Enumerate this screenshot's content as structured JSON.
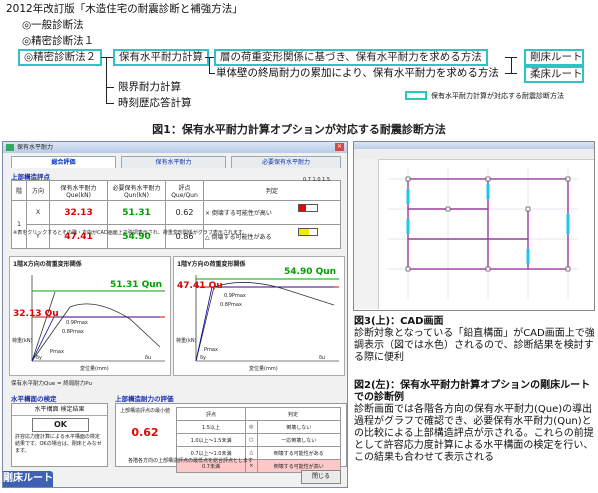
{
  "diagram": {
    "header": "2012年改訂版「木造住宅の耐震診断と補強方法」",
    "ippan": "◎一般診断法",
    "seimitsu1": "◎精密診断法１",
    "seimitsu2": "◎精密診断法２",
    "hoyu_box": "保有水平耐力計算",
    "method_a": "層の荷重変形関係に基づき、保有水平耐力を求める方法",
    "method_b": "単体壁の終局耐力の累加により、保有水平耐力を求める方法",
    "gosho": "剛床ルート",
    "jushou": "柔床ルート",
    "genkai": "限界耐力計算",
    "jikoku": "時刻歴応答計算",
    "legend_text": "保有水平耐力計算が対応する耐震診断方法",
    "figure_caption": "図1：保有水平耐力計算オプションが対応する耐震診断方法",
    "accent_color": "#2ec4c4"
  },
  "dialog": {
    "title": "保有水平耐力",
    "tabs": [
      "総合評価",
      "保有水平耐力",
      "必要保有水平耐力"
    ],
    "upper_eval": "上部構造評点",
    "table": {
      "headers": [
        "階",
        "方向",
        "保有水平耐力\nQue(kN)",
        "必要保有水平耐力\nQun(kN)",
        "評点\nQue/Qun",
        "判定"
      ],
      "floor": "1",
      "rows": [
        {
          "dir": "X",
          "que": "32.13",
          "qun": "51.31",
          "score": "0.62",
          "judge": "× 倒壊する可能性が高い"
        },
        {
          "dir": "Y",
          "que": "47.41",
          "qun": "54.90",
          "score": "0.86",
          "judge": "△ 倒壊する可能性がある"
        }
      ],
      "scale": [
        "0.7",
        "1.0",
        "1.5"
      ],
      "note": "※表をクリックするとその階・方向がCAD画面上で強調表示され、荷重変形関係がグラフ表示されます。"
    },
    "graph_x": {
      "title": "1階X方向の荷重変形関係",
      "qun_label": "51.31 Qun",
      "qu_label": "32.13 Qu",
      "point_a": "0.9Pmax",
      "point_b": "0.8Pmax",
      "point_c": "Pmax",
      "dy": "δy",
      "du": "δu",
      "xlabel": "変位量(mm)",
      "ylabel": "荷重(kN)"
    },
    "graph_y": {
      "title": "1階Y方向の荷重変形関係",
      "qun_label": "54.90 Qun",
      "qu_label": "47.41 Qu",
      "point_a": "0.9Pmax",
      "point_b": "0.8Pmax",
      "point_c": "Pmax",
      "dy": "δy",
      "du": "δu",
      "xlabel": "変位量(mm)",
      "ylabel": "荷重(kN)"
    },
    "formula": "保有水平耐力Que = 終局耐力Pu",
    "horizontal_check": "水平構面の検定",
    "check_result_label": "水平構面 検定結果",
    "check_result": "OK",
    "check_note": "許容応力度計算による水平構面の検定結果です。OKの場合は、剛床とみなせます。",
    "upper_capacity": "上部構造耐力の評価",
    "min_score_label": "上部構造評点の最小値",
    "min_score": "0.62",
    "eval_header": [
      "評点",
      "判定"
    ],
    "eval_rows": [
      {
        "range": "1.5以上",
        "mark": "◎",
        "text": "倒壊しない"
      },
      {
        "range": "1.0以上〜1.5未満",
        "mark": "○",
        "text": "一応倒壊しない"
      },
      {
        "range": "0.7以上〜1.0未満",
        "mark": "△",
        "text": "倒壊する可能性がある"
      },
      {
        "range": "0.7未満",
        "mark": "×",
        "text": "倒壊する可能性が高い"
      }
    ],
    "eval_note": "各階各方向の上部構造評点の最低点を総合評点とします",
    "close_btn": "閉じる",
    "route_badge": "剛床ルート"
  },
  "captions": {
    "fig3_title": "図3(上)：CAD画面",
    "fig3_body": "診断対象となっている「鉛直構面」がCAD画面上で強調表示（図では水色）されるので、診断結果を検討する際に便利",
    "fig2_title": "図2(左)：保有水平耐力計算オプションの剛床ルートでの診断例",
    "fig2_body": "診断画面では各階各方向の保有水平耐力(Que)の導出過程がグラフで確認でき、必要保有水平耐力(Qun)との比較による上部構造評点が示される。これらの前提として許容応力度計算による水平構面の検定を行い、この結果も合わせて表示される"
  }
}
